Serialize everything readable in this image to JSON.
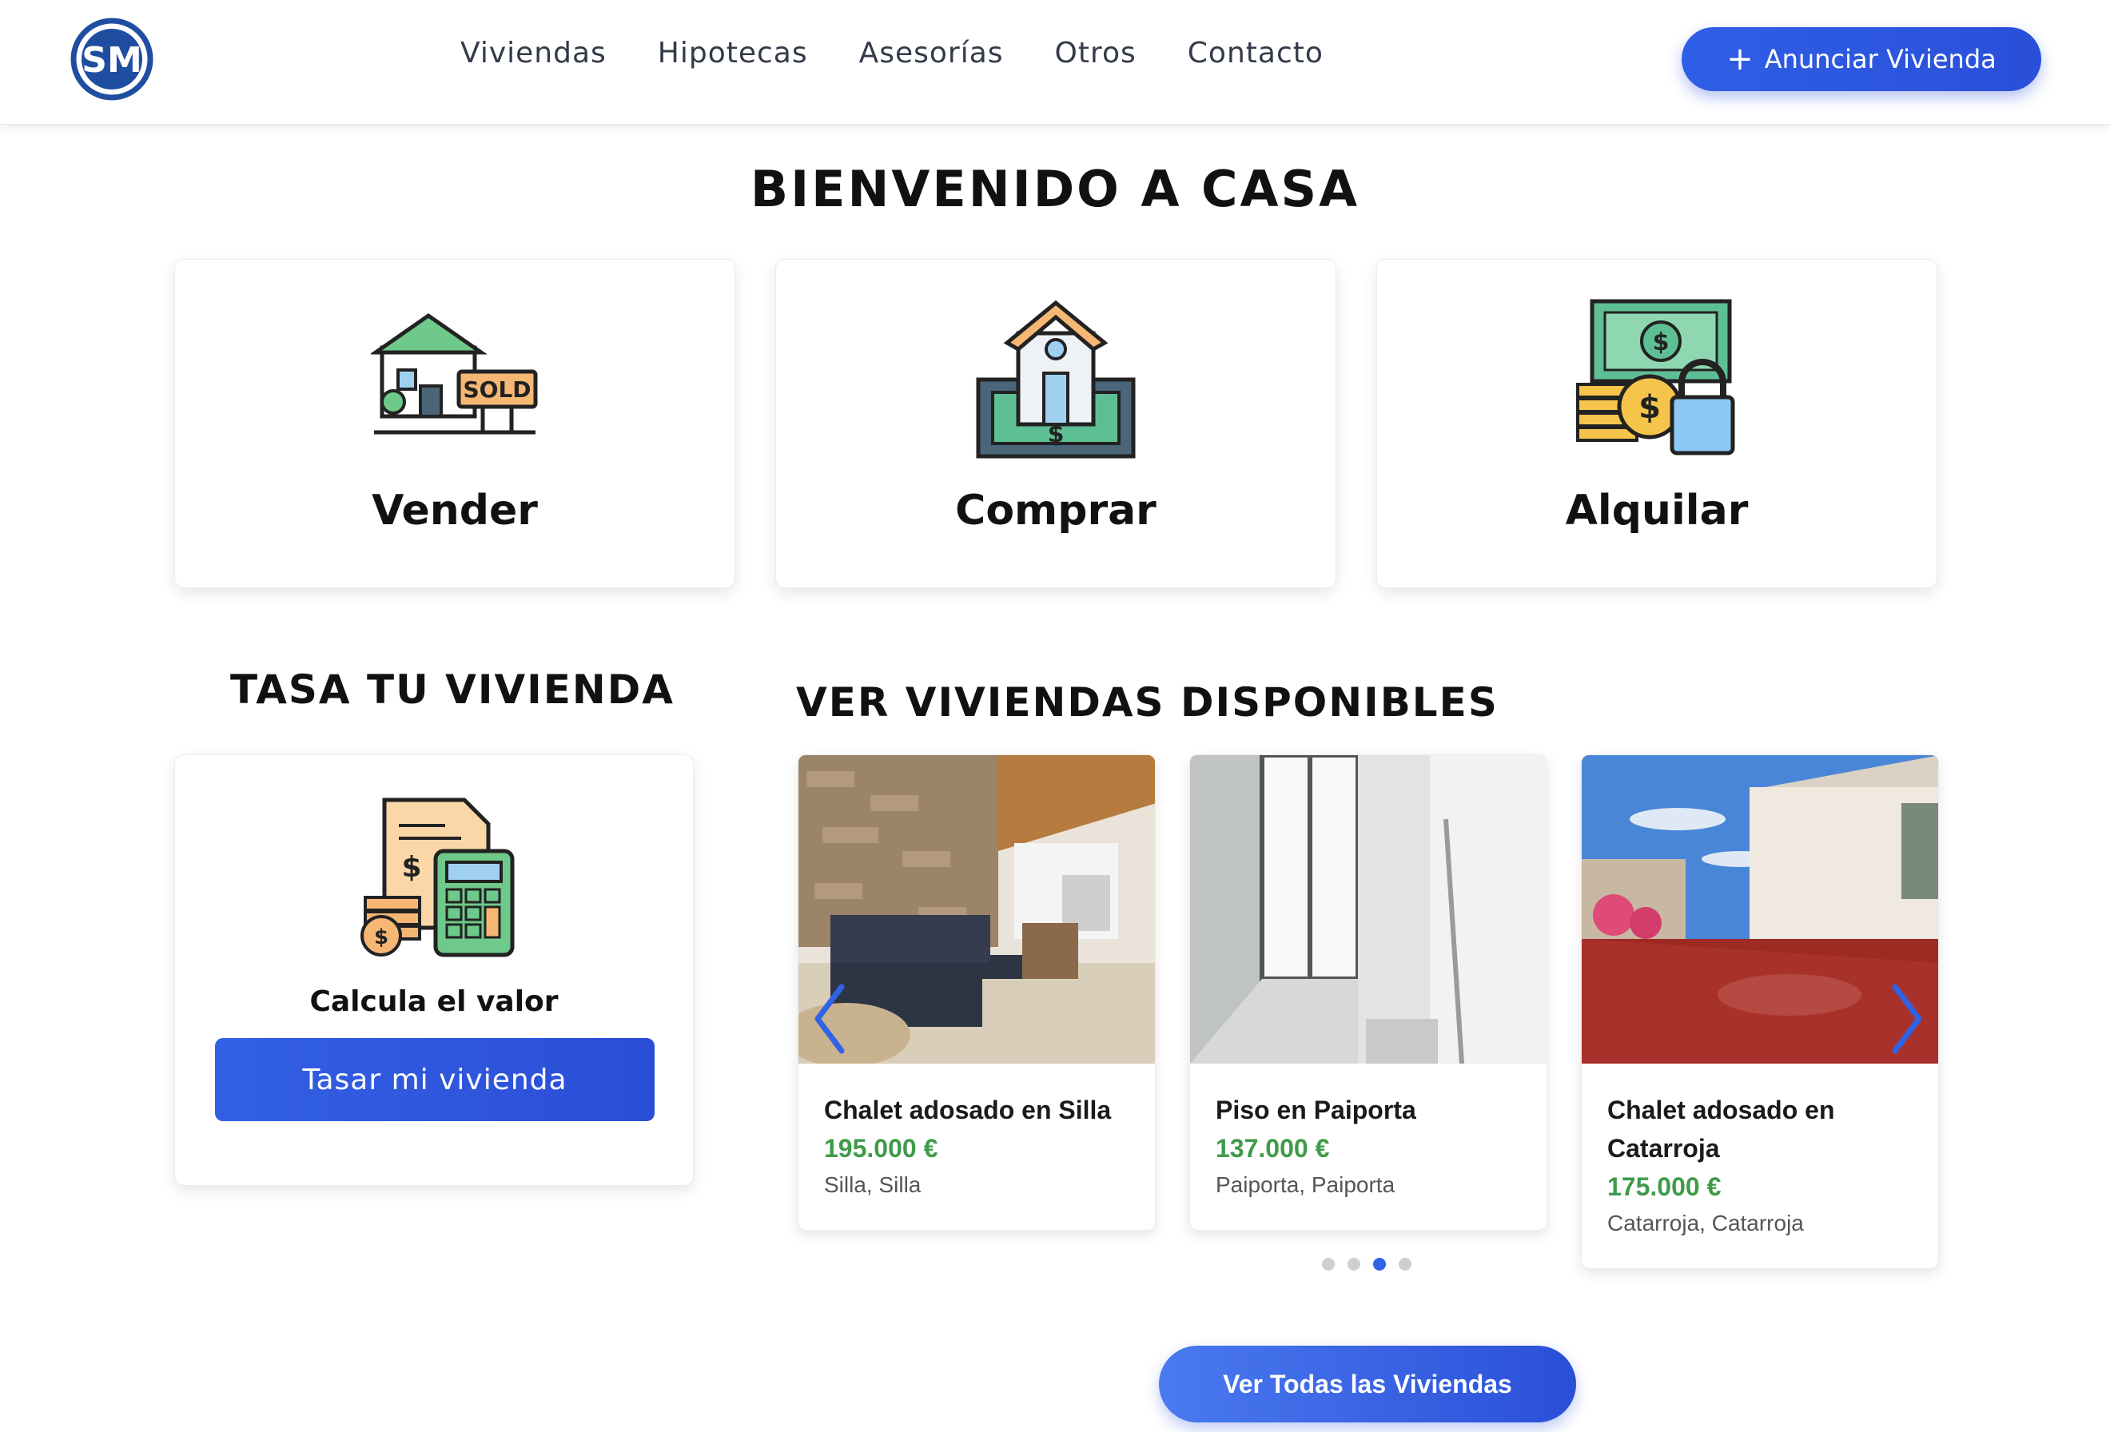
{
  "header": {
    "nav": [
      "Viviendas",
      "Hipotecas",
      "Asesorías",
      "Otros",
      "Contacto"
    ],
    "cta_label": "Anunciar Vivienda",
    "cta_icon": "plus-icon",
    "brand_color": "#2c53dc"
  },
  "hero": {
    "title": "BIENVENIDO A CASA"
  },
  "services": [
    {
      "label": "Vender",
      "icon": "house-sold-sign-icon"
    },
    {
      "label": "Comprar",
      "icon": "house-money-icon"
    },
    {
      "label": "Alquilar",
      "icon": "cash-lock-icon"
    }
  ],
  "valuation": {
    "heading": "TASA TU VIVIENDA",
    "label": "Calcula el valor",
    "button": "Tasar mi vivienda",
    "icon": "calculator-invoice-icon"
  },
  "listings": {
    "heading": "VER VIVIENDAS DISPONIBLES",
    "items": [
      {
        "title": "Chalet adosado en Silla",
        "price": "195.000 €",
        "location": "Silla, Silla"
      },
      {
        "title": "Piso en Paiporta",
        "price": "137.000 €",
        "location": "Paiporta, Paiporta"
      },
      {
        "title": "Chalet adosado en Catarroja",
        "price": "175.000 €",
        "location": "Catarroja, Catarroja"
      }
    ],
    "price_color": "#3f9b4a",
    "dots": 4,
    "active_dot": 3,
    "view_all": "Ver Todas las Viviendas"
  }
}
